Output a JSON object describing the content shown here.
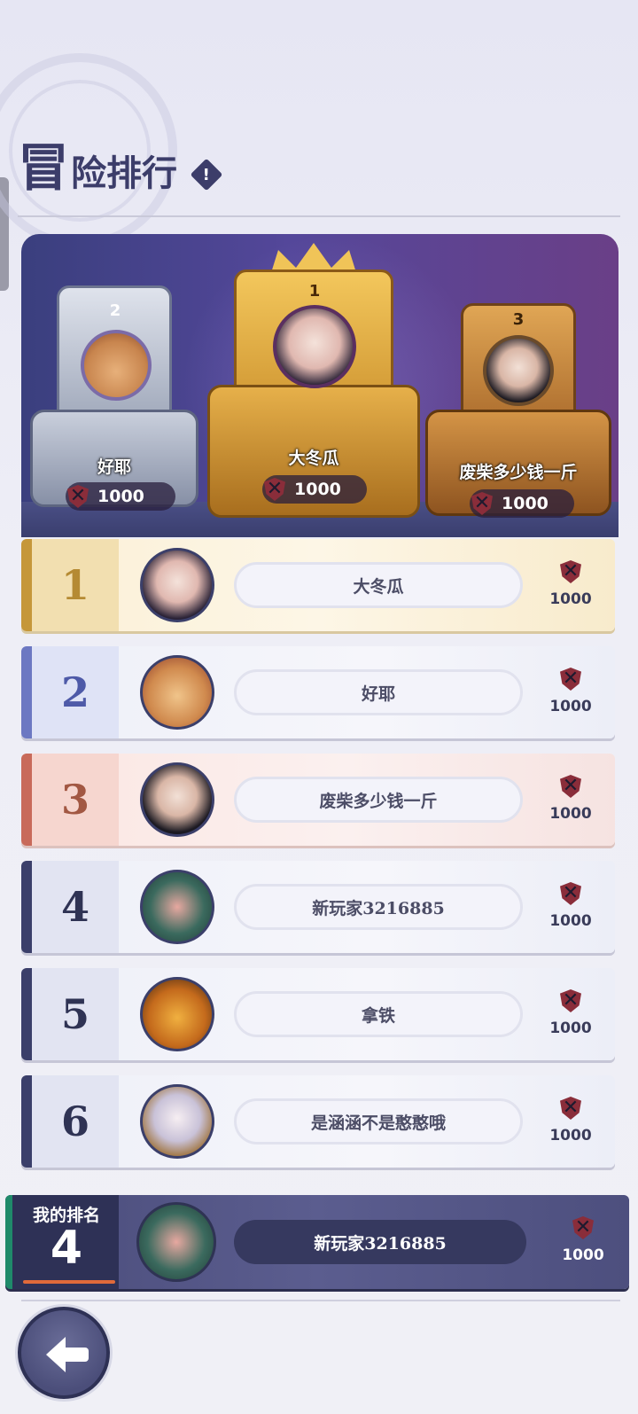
{
  "header": {
    "title_first_char": "冒",
    "title_rest": "险排行",
    "info_icon_text": "!"
  },
  "podium": [
    {
      "rank": "2",
      "name": "好耶",
      "score": "1000"
    },
    {
      "rank": "1",
      "name": "大冬瓜",
      "score": "1000"
    },
    {
      "rank": "3",
      "name": "废柴多少钱一斤",
      "score": "1000"
    }
  ],
  "ranking": [
    {
      "rank": "1",
      "name": "大冬瓜",
      "reward": "1000"
    },
    {
      "rank": "2",
      "name": "好耶",
      "reward": "1000"
    },
    {
      "rank": "3",
      "name": "废柴多少钱一斤",
      "reward": "1000"
    },
    {
      "rank": "4",
      "name": "新玩家3216885",
      "reward": "1000"
    },
    {
      "rank": "5",
      "name": "拿铁",
      "reward": "1000"
    },
    {
      "rank": "6",
      "name": "是涵涵不是憨憨哦",
      "reward": "1000"
    }
  ],
  "my_rank": {
    "label": "我的排名",
    "rank": "4",
    "name": "新玩家3216885",
    "reward": "1000"
  },
  "icons": {
    "reward": "crossed-swords-shield-icon",
    "back": "back-arrow-icon"
  }
}
